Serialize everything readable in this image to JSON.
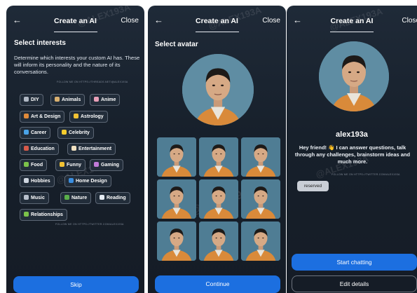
{
  "screens": [
    {
      "header": {
        "back_icon": "arrow-left-icon",
        "title": "Create an AI",
        "close_label": "Close"
      },
      "watermark": "@ALEX193A",
      "section_title": "Select interests",
      "description": "Determine which interests your custom AI has. These will inform its personality and the nature of its conversations.",
      "footer_credit_top": "FOLLOW ME ON HTTPS://THREADS.NET/@ALEX193A",
      "footer_credit_bottom": "FOLLOW ME ON HTTPS://TWITTER.COM/ALEX193A",
      "interests": [
        {
          "label": "DIY",
          "icon": "tools-icon",
          "color": "#b0b8c4"
        },
        {
          "label": "Animals",
          "icon": "animal-icon",
          "color": "#d9b070"
        },
        {
          "label": "Anime",
          "icon": "anime-icon",
          "color": "#e8a0b8"
        },
        {
          "label": "Art & Design",
          "icon": "palette-icon",
          "color": "#e08a3a"
        },
        {
          "label": "Astrology",
          "icon": "zodiac-icon",
          "color": "#f2c233"
        },
        {
          "label": "Career",
          "icon": "briefcase-icon",
          "color": "#4aa3e8"
        },
        {
          "label": "Celebrity",
          "icon": "star-icon",
          "color": "#f4cc2e"
        },
        {
          "label": "Education",
          "icon": "books-icon",
          "color": "#d65a4a"
        },
        {
          "label": "Entertainment",
          "icon": "popcorn-icon",
          "color": "#f0e0c0"
        },
        {
          "label": "Food",
          "icon": "food-icon",
          "color": "#7cc24a"
        },
        {
          "label": "Funny",
          "icon": "laugh-icon",
          "color": "#f2c233"
        },
        {
          "label": "Gaming",
          "icon": "joystick-icon",
          "color": "#c07ad8"
        },
        {
          "label": "Hobbies",
          "icon": "hobbies-icon",
          "color": "#cfd6e0"
        },
        {
          "label": "Home Design",
          "icon": "sofa-icon",
          "color": "#3a8ee0"
        },
        {
          "label": "Music",
          "icon": "headphones-icon",
          "color": "#b8c0cc"
        },
        {
          "label": "Nature",
          "icon": "plant-icon",
          "color": "#5aae4a"
        },
        {
          "label": "Reading",
          "icon": "book-icon",
          "color": "#e6ebf2"
        },
        {
          "label": "Relationships",
          "icon": "heart-icon",
          "color": "#7cc24a"
        }
      ],
      "primary_button": "Skip"
    },
    {
      "header": {
        "back_icon": "arrow-left-icon",
        "title": "Create an AI",
        "close_label": "Close"
      },
      "watermark": "@ALEX193A",
      "section_title": "Select avatar",
      "avatar_grid_count": 9,
      "primary_button": "Continue"
    },
    {
      "header": {
        "back_icon": "arrow-left-icon",
        "title": "Create an AI",
        "close_label": "Close"
      },
      "watermark": "@ALEX193A",
      "username": "alex193a",
      "bio": "Hey friend! 👋 I can answer questions, talk through any challenges, brainstorm ideas and much more.",
      "footer_credit": "FOLLOW ME ON HTTPS://TWITTER.COM/ALEX193A",
      "reserved_badge": "reserved",
      "primary_button": "Start chatting",
      "secondary_button": "Edit details"
    }
  ],
  "colors": {
    "accent": "#1c6fe0",
    "background": "#1a2430",
    "avatar_bg": "#5f8da3",
    "jacket": "#d98a3a"
  }
}
